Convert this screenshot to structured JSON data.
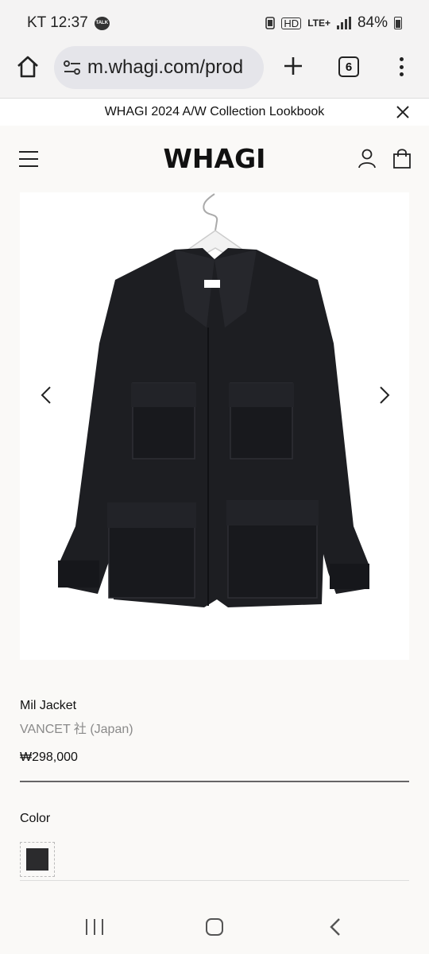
{
  "status_bar": {
    "carrier_time": "KT 12:37",
    "talk_badge": "TALK",
    "hd_label": "HD",
    "network": "LTE+",
    "battery": "84%"
  },
  "browser": {
    "url": "m.whagi.com/prod",
    "tab_count": "6"
  },
  "banner": {
    "text": "WHAGI 2024 A/W Collection Lookbook"
  },
  "header": {
    "logo": "WHAGI"
  },
  "product": {
    "name": "Mil Jacket",
    "brand": "VANCET 社 (Japan)",
    "price": "₩298,000",
    "color_label": "Color",
    "swatch_color": "#2b2b2d",
    "image_description_icon": "black-jacket-photo"
  }
}
